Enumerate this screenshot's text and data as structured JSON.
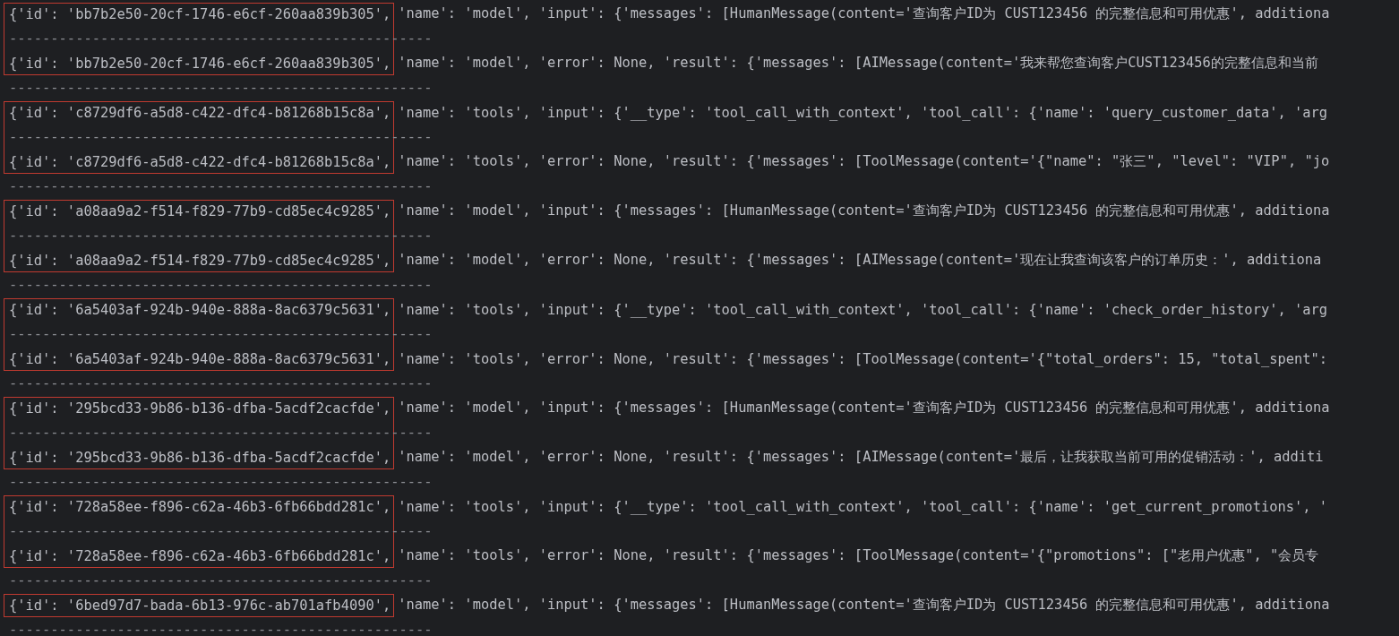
{
  "groups": [
    {
      "highlighted": true,
      "lines": [
        {
          "id_text": "{'id': 'bb7b2e50-20cf-1746-e6cf-260aa839b305',",
          "rest": "'name': 'model', 'input': {'messages': [HumanMessage(content='查询客户ID为 CUST123456 的完整信息和可用优惠', additiona",
          "separator": "---------------------------------------------------"
        },
        {
          "id_text": "{'id': 'bb7b2e50-20cf-1746-e6cf-260aa839b305',",
          "rest": "'name': 'model', 'error': None, 'result': {'messages': [AIMessage(content='我来帮您查询客户CUST123456的完整信息和当前",
          "separator": "---------------------------------------------------"
        }
      ]
    },
    {
      "highlighted": true,
      "lines": [
        {
          "id_text": "{'id': 'c8729df6-a5d8-c422-dfc4-b81268b15c8a',",
          "rest": "'name': 'tools', 'input': {'__type': 'tool_call_with_context', 'tool_call': {'name': 'query_customer_data', 'arg",
          "separator": "---------------------------------------------------"
        },
        {
          "id_text": "{'id': 'c8729df6-a5d8-c422-dfc4-b81268b15c8a',",
          "rest": "'name': 'tools', 'error': None, 'result': {'messages': [ToolMessage(content='{\"name\": \"张三\", \"level\": \"VIP\", \"jo",
          "separator": "---------------------------------------------------"
        }
      ]
    },
    {
      "highlighted": true,
      "lines": [
        {
          "id_text": "{'id': 'a08aa9a2-f514-f829-77b9-cd85ec4c9285',",
          "rest": "'name': 'model', 'input': {'messages': [HumanMessage(content='查询客户ID为 CUST123456 的完整信息和可用优惠', additiona",
          "separator": "---------------------------------------------------"
        },
        {
          "id_text": "{'id': 'a08aa9a2-f514-f829-77b9-cd85ec4c9285',",
          "rest": "'name': 'model', 'error': None, 'result': {'messages': [AIMessage(content='现在让我查询该客户的订单历史：', additiona",
          "separator": "---------------------------------------------------"
        }
      ]
    },
    {
      "highlighted": true,
      "lines": [
        {
          "id_text": "{'id': '6a5403af-924b-940e-888a-8ac6379c5631',",
          "rest": "'name': 'tools', 'input': {'__type': 'tool_call_with_context', 'tool_call': {'name': 'check_order_history', 'arg",
          "separator": "---------------------------------------------------"
        },
        {
          "id_text": "{'id': '6a5403af-924b-940e-888a-8ac6379c5631',",
          "rest": "'name': 'tools', 'error': None, 'result': {'messages': [ToolMessage(content='{\"total_orders\": 15, \"total_spent\":",
          "separator": "---------------------------------------------------"
        }
      ]
    },
    {
      "highlighted": true,
      "lines": [
        {
          "id_text": "{'id': '295bcd33-9b86-b136-dfba-5acdf2cacfde',",
          "rest": "'name': 'model', 'input': {'messages': [HumanMessage(content='查询客户ID为 CUST123456 的完整信息和可用优惠', additiona",
          "separator": "---------------------------------------------------"
        },
        {
          "id_text": "{'id': '295bcd33-9b86-b136-dfba-5acdf2cacfde',",
          "rest": "'name': 'model', 'error': None, 'result': {'messages': [AIMessage(content='最后，让我获取当前可用的促销活动：', additi",
          "separator": "---------------------------------------------------"
        }
      ]
    },
    {
      "highlighted": true,
      "lines": [
        {
          "id_text": "{'id': '728a58ee-f896-c62a-46b3-6fb66bdd281c',",
          "rest": "'name': 'tools', 'input': {'__type': 'tool_call_with_context', 'tool_call': {'name': 'get_current_promotions', '",
          "separator": "---------------------------------------------------"
        },
        {
          "id_text": "{'id': '728a58ee-f896-c62a-46b3-6fb66bdd281c',",
          "rest": "'name': 'tools', 'error': None, 'result': {'messages': [ToolMessage(content='{\"promotions\": [\"老用户优惠\", \"会员专",
          "separator": "---------------------------------------------------"
        }
      ]
    },
    {
      "highlighted": true,
      "lines": [
        {
          "id_text": "{'id': '6bed97d7-bada-6b13-976c-ab701afb4090',",
          "rest": "'name': 'model', 'input': {'messages': [HumanMessage(content='查询客户ID为 CUST123456 的完整信息和可用优惠', additiona",
          "separator": "---------------------------------------------------"
        }
      ]
    }
  ]
}
